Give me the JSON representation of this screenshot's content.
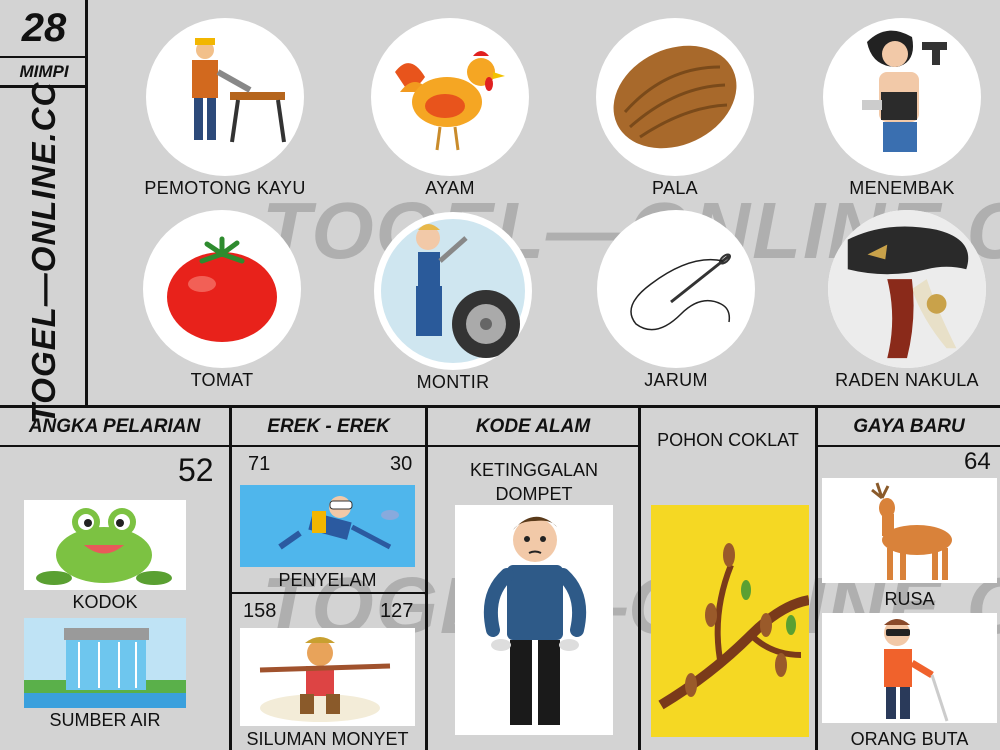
{
  "header": {
    "number": "28",
    "subtitle": "MIMPI",
    "site": "TOGEL—ONLINE.CC"
  },
  "watermark": "TOGEL—ONLINE.CC",
  "dreams": [
    {
      "label": "PEMOTONG KAYU",
      "icon": "woodcutter-icon"
    },
    {
      "label": "AYAM",
      "icon": "rooster-icon"
    },
    {
      "label": "PALA",
      "icon": "nutmeg-icon"
    },
    {
      "label": "MENEMBAK",
      "icon": "shooter-icon"
    },
    {
      "label": "TOMAT",
      "icon": "tomato-icon"
    },
    {
      "label": "MONTIR",
      "icon": "mechanic-icon"
    },
    {
      "label": "JARUM",
      "icon": "needle-icon"
    },
    {
      "label": "RADEN NAKULA",
      "icon": "wayang-icon"
    }
  ],
  "sections": {
    "angka_pelarian": {
      "title": "ANGKA PELARIAN",
      "number": "52",
      "items": [
        {
          "label": "KODOK",
          "icon": "frog-icon"
        },
        {
          "label": "SUMBER AIR",
          "icon": "dam-icon"
        }
      ]
    },
    "erek_erek": {
      "title": "EREK - EREK",
      "items": [
        {
          "label": "PENYELAM",
          "left": "71",
          "right": "30",
          "icon": "diver-icon"
        },
        {
          "label": "SILUMAN MONYET",
          "left": "158",
          "right": "127",
          "icon": "monkey-king-icon"
        }
      ]
    },
    "kode_alam": {
      "title": "KODE ALAM",
      "label": "KETINGGALAN DOMPET",
      "icon": "empty-pockets-icon"
    },
    "pohon_coklat": {
      "label": "POHON COKLAT",
      "icon": "cocoa-tree-icon"
    },
    "gaya_baru": {
      "title": "GAYA BARU",
      "number": "64",
      "items": [
        {
          "label": "RUSA",
          "icon": "deer-icon"
        },
        {
          "label": "ORANG BUTA",
          "icon": "blind-man-icon"
        }
      ]
    }
  }
}
